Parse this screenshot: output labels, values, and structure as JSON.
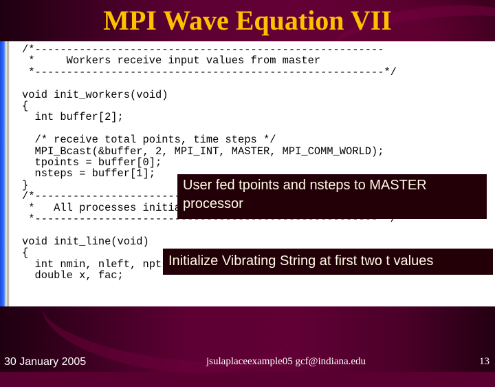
{
  "slide": {
    "title": "MPI Wave Equation VII",
    "colors": {
      "title": "#ffc000",
      "background": "#5e0034",
      "callout_bg": "#230008",
      "callout_text": "#fffbe6"
    }
  },
  "code": {
    "lines": [
      "/*-------------------------------------------------------",
      " *     Workers receive input values from master",
      " *-------------------------------------------------------*/",
      "",
      "void init_workers(void)",
      "{",
      "  int buffer[2];",
      "",
      "  /* receive total points, time steps */",
      "  MPI_Bcast(&buffer, 2, MPI_INT, MASTER, MPI_COMM_WORLD);",
      "  tpoints = buffer[0];",
      "  nsteps = buffer[1];",
      "}",
      "/*-------------------------------------------------------",
      " *   All processes initialize points on line",
      " *------------------------------------------------------ */",
      "",
      "void init_line(void)",
      "{",
      "  int nmin, nleft, npts, i, j, k;",
      "  double x, fac;"
    ]
  },
  "callouts": {
    "user_fed": "User fed tpoints and nsteps to MASTER processor",
    "init_string": "Initialize Vibrating String at first two t values"
  },
  "footer": {
    "date": "30 January 2005",
    "center": "jsulaplaceexample05  gcf@indiana.edu",
    "page_number": "13"
  }
}
